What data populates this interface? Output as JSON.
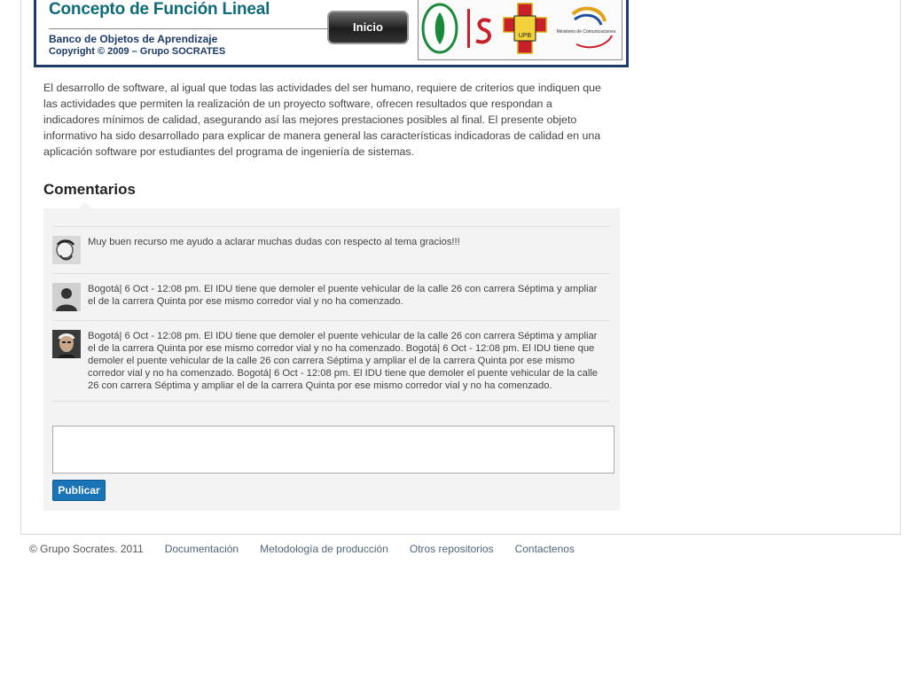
{
  "banner": {
    "title": "Concepto de Función Lineal",
    "subtitle": "Banco de Objetos de Aprendizaje",
    "copyright": "Copyright © 2009 – Grupo SOCRATES",
    "home_button": "Inicio",
    "logo_ministerio_text": "Ministerio de Comunicaciones",
    "logo_upb_text": "UPB"
  },
  "description": "El desarrollo de software, al igual que todas las actividades del ser humano, requiere de criterios que indiquen que las actividades que permiten la realización de un proyecto software, ofrecen resultados que respondan a indicadores mínimos de calidad, asegurando así las mejores prestaciones posibles al final. El presente objeto informativo ha sido desarrollado para explicar de manera general las características indicadoras de calidad en una aplicación software por estudiantes del programa de ingeniería de sistemas.",
  "comments": {
    "heading": "Comentarios",
    "items": [
      {
        "avatar": "avatar-photo-1",
        "text": "Muy buen recurso me ayudo a aclarar muchas dudas con respecto al tema gracios!!!"
      },
      {
        "avatar": "avatar-placeholder",
        "text": "Bogotá| 6 Oct - 12:08 pm. El IDU tiene que demoler el puente vehicular de la calle 26 con carrera Séptima y ampliar el de la carrera Quinta por ese mismo corredor vial y no ha comenzado."
      },
      {
        "avatar": "avatar-photo-2",
        "text": "Bogotá| 6 Oct - 12:08 pm. El IDU tiene que demoler el puente vehicular de la calle 26 con carrera Séptima y ampliar el de la carrera Quinta por ese mismo corredor vial y no ha comenzado. Bogotá| 6 Oct - 12:08 pm. El IDU tiene que demoler el puente vehicular de la calle 26 con carrera Séptima y ampliar el de la carrera Quinta por ese mismo corredor vial y no ha comenzado. Bogotá| 6 Oct - 12:08 pm. El IDU tiene que demoler el puente vehicular de la calle 26 con carrera Séptima y ampliar el de la carrera Quinta por ese mismo corredor vial y no ha comenzado."
      }
    ],
    "textarea_value": "",
    "submit_label": "Publicar"
  },
  "footer": {
    "copyright": "© Grupo Socrates. 2011",
    "links": [
      "Documentación",
      "Metodología de producción",
      "Otros repositorios",
      "Contactenos"
    ]
  },
  "colors": {
    "banner_border": "#1d3a68",
    "title": "#0e6b79",
    "button": "#1a74b8",
    "link": "#50657a"
  }
}
